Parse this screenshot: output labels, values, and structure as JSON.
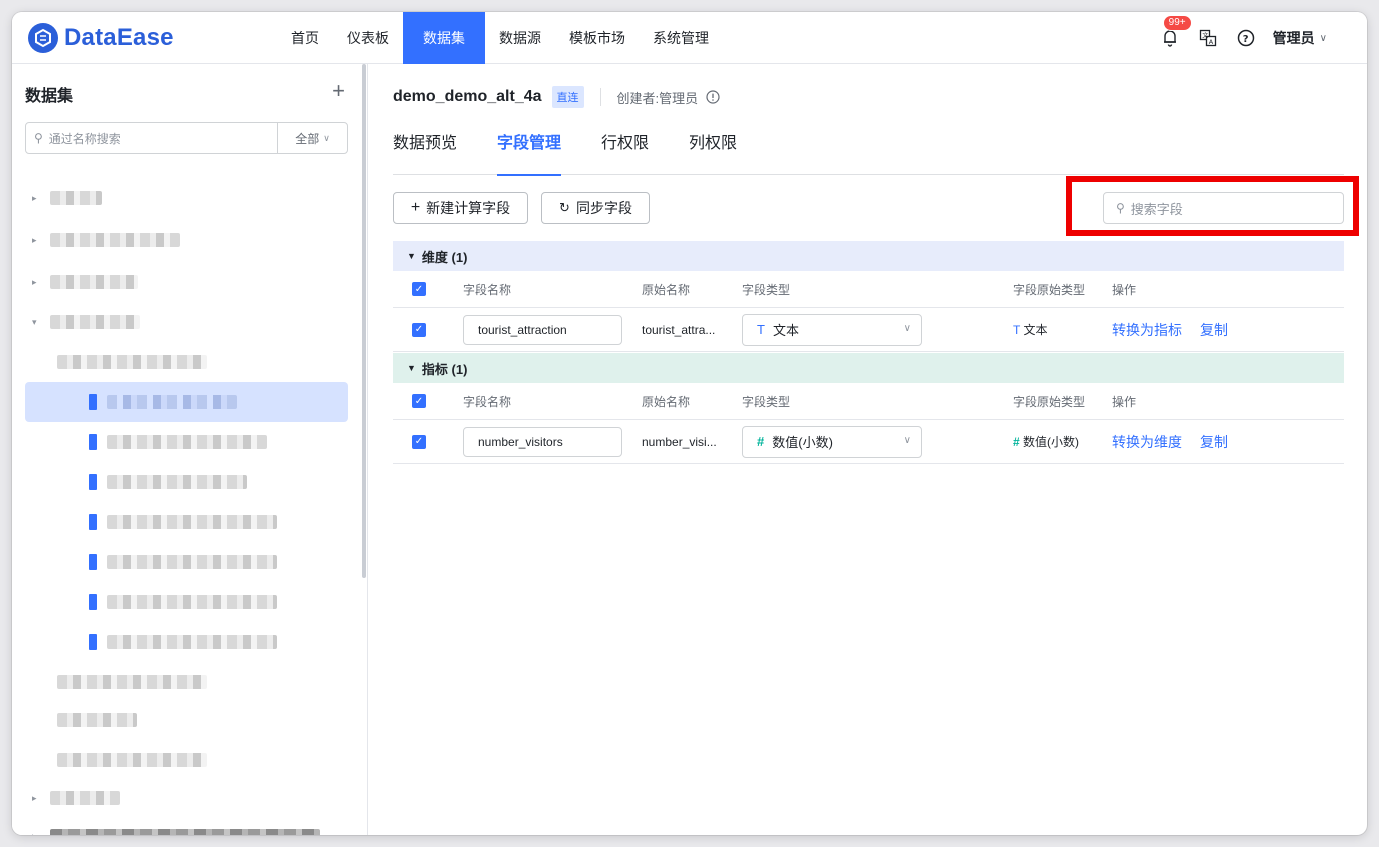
{
  "brand": {
    "name": "DataEase"
  },
  "nav": {
    "items": [
      "首页",
      "仪表板",
      "数据集",
      "数据源",
      "模板市场",
      "系统管理"
    ],
    "active_index": 2
  },
  "topbar": {
    "notification_badge": "99+",
    "user": "管理员"
  },
  "sidebar": {
    "title": "数据集",
    "search_placeholder": "通过名称搜索",
    "filter_label": "全部"
  },
  "dataset": {
    "name": "demo_demo_alt_4a",
    "mode_tag": "直连",
    "creator": "创建者:管理员"
  },
  "tabs": [
    "数据预览",
    "字段管理",
    "行权限",
    "列权限"
  ],
  "active_tab_index": 1,
  "toolbar": {
    "new_calc_field": "新建计算字段",
    "sync_fields": "同步字段",
    "search_placeholder": "搜索字段"
  },
  "columns": [
    "字段名称",
    "原始名称",
    "字段类型",
    "字段原始类型",
    "操作"
  ],
  "dimensions": {
    "header": "维度 (1)",
    "rows": [
      {
        "field_name": "tourist_attraction",
        "original_name": "tourist_attra...",
        "type_icon": "T",
        "type": "文本",
        "orig_type_icon": "T",
        "orig_type": "文本",
        "action_convert": "转换为指标",
        "action_copy": "复制"
      }
    ]
  },
  "metrics": {
    "header": "指标 (1)",
    "rows": [
      {
        "field_name": "number_visitors",
        "original_name": "number_visi...",
        "type_icon": "#",
        "type": "数值(小数)",
        "orig_type_icon": "#",
        "orig_type": "数值(小数)",
        "action_convert": "转换为维度",
        "action_copy": "复制"
      }
    ]
  },
  "colors": {
    "accent": "#3370ff",
    "highlight": "#ee0000",
    "number_type": "#04b49c"
  }
}
